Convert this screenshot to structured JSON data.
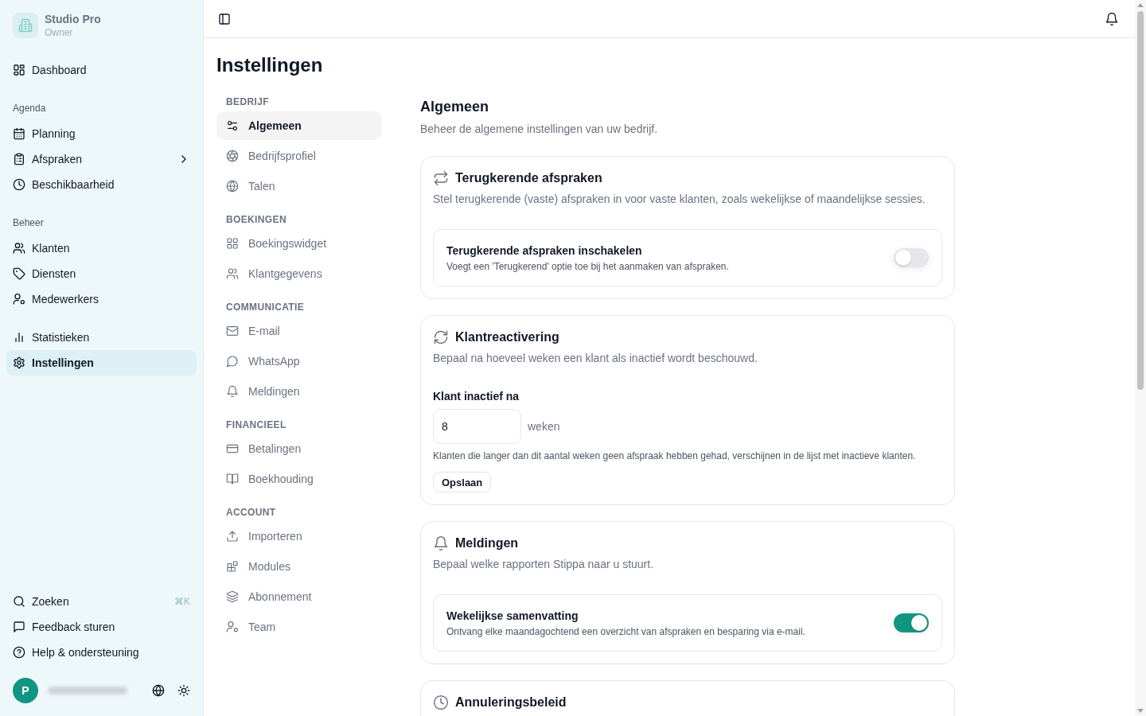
{
  "sidebar": {
    "brand": {
      "name": "Studio Pro",
      "role": "Owner"
    },
    "groups": [
      {
        "items": [
          {
            "label": "Dashboard",
            "selected": false
          }
        ]
      },
      {
        "title": "Agenda",
        "items": [
          {
            "label": "Planning",
            "selected": false
          },
          {
            "label": "Afspraken",
            "selected": false,
            "expanded": false
          },
          {
            "label": "Beschikbaarheid",
            "selected": false
          }
        ]
      },
      {
        "title": "Beheer",
        "items": [
          {
            "label": "Klanten",
            "selected": false
          },
          {
            "label": "Diensten",
            "selected": false
          },
          {
            "label": "Medewerkers",
            "selected": false
          }
        ]
      },
      {
        "items": [
          {
            "label": "Statistieken",
            "selected": false
          },
          {
            "label": "Instellingen",
            "selected": true
          }
        ]
      }
    ],
    "footer": [
      {
        "label": "Zoeken",
        "shortcut": "⌘K"
      },
      {
        "label": "Feedback sturen"
      },
      {
        "label": "Help & ondersteuning"
      }
    ],
    "user": {
      "initial": "P"
    }
  },
  "page": {
    "title": "Instellingen"
  },
  "settings_nav": [
    {
      "title": "BEDRIJF",
      "items": [
        {
          "label": "Algemeen",
          "selected": true
        },
        {
          "label": "Bedrijfsprofiel",
          "selected": false
        },
        {
          "label": "Talen",
          "selected": false
        }
      ]
    },
    {
      "title": "BOEKINGEN",
      "items": [
        {
          "label": "Boekingswidget",
          "selected": false
        },
        {
          "label": "Klantgegevens",
          "selected": false
        }
      ]
    },
    {
      "title": "COMMUNICATIE",
      "items": [
        {
          "label": "E-mail",
          "selected": false
        },
        {
          "label": "WhatsApp",
          "selected": false
        },
        {
          "label": "Meldingen",
          "selected": false
        }
      ]
    },
    {
      "title": "FINANCIEEL",
      "items": [
        {
          "label": "Betalingen",
          "selected": false
        },
        {
          "label": "Boekhouding",
          "selected": false
        }
      ]
    },
    {
      "title": "ACCOUNT",
      "items": [
        {
          "label": "Importeren",
          "selected": false
        },
        {
          "label": "Modules",
          "selected": false
        },
        {
          "label": "Abonnement",
          "selected": false
        },
        {
          "label": "Team",
          "selected": false
        }
      ]
    }
  ],
  "content": {
    "title": "Algemeen",
    "description": "Beheer de algemene instellingen van uw bedrijf.",
    "cards": [
      {
        "kind": "toggle",
        "title": "Terugkerende afspraken",
        "description": "Stel terugkerende (vaste) afspraken in voor vaste klanten, zoals wekelijkse of maandelijkse sessies.",
        "setting": {
          "label": "Terugkerende afspraken inschakelen",
          "description": "Voegt een 'Terugkerend' optie toe bij het aanmaken van afspraken.",
          "on": false
        }
      },
      {
        "kind": "number",
        "title": "Klantreactivering",
        "description": "Bepaal na hoeveel weken een klant als inactief wordt beschouwd.",
        "field": {
          "label": "Klant inactief na",
          "value": "8",
          "unit": "weken",
          "help": "Klanten die langer dan dit aantal weken geen afspraak hebben gehad, verschijnen in de lijst met inactieve klanten."
        },
        "button": "Opslaan"
      },
      {
        "kind": "toggle",
        "title": "Meldingen",
        "description": "Bepaal welke rapporten Stippa naar u stuurt.",
        "setting": {
          "label": "Wekelijkse samenvatting",
          "description": "Ontvang elke maandagochtend een overzicht van afspraken en besparing via e-mail.",
          "on": true
        }
      },
      {
        "kind": "partial",
        "title": "Annuleringsbeleid"
      }
    ]
  }
}
